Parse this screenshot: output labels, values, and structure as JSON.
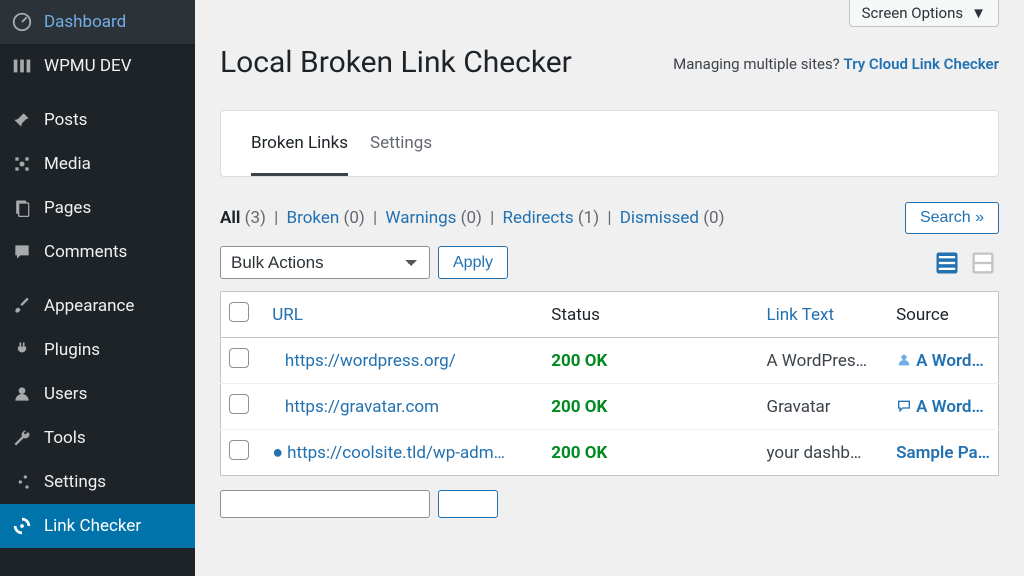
{
  "sidebar": {
    "items": [
      {
        "label": "Dashboard",
        "icon": "dashboard"
      },
      {
        "label": "WPMU DEV",
        "icon": "wpmudev"
      },
      {
        "label": "Posts",
        "icon": "pin"
      },
      {
        "label": "Media",
        "icon": "media"
      },
      {
        "label": "Pages",
        "icon": "pages"
      },
      {
        "label": "Comments",
        "icon": "comment"
      },
      {
        "label": "Appearance",
        "icon": "brush"
      },
      {
        "label": "Plugins",
        "icon": "plug"
      },
      {
        "label": "Users",
        "icon": "user"
      },
      {
        "label": "Tools",
        "icon": "wrench"
      },
      {
        "label": "Settings",
        "icon": "sliders"
      },
      {
        "label": "Link Checker",
        "icon": "linkchecker",
        "active": true
      }
    ]
  },
  "screen_options": "Screen Options",
  "page_title": "Local Broken Link Checker",
  "subtitle_text": "Managing multiple sites? ",
  "subtitle_link": "Try Cloud Link Checker",
  "tabs": [
    {
      "label": "Broken Links",
      "active": true
    },
    {
      "label": "Settings",
      "active": false
    }
  ],
  "filters": {
    "all_label": "All",
    "all_count": "(3)",
    "broken_label": "Broken",
    "broken_count": "(0)",
    "warnings_label": "Warnings",
    "warnings_count": "(0)",
    "redirects_label": "Redirects",
    "redirects_count": "(1)",
    "dismissed_label": "Dismissed",
    "dismissed_count": "(0)"
  },
  "search_button": "Search »",
  "bulk_select": "Bulk Actions",
  "apply_button": "Apply",
  "table": {
    "headers": {
      "url": "URL",
      "status": "Status",
      "linktext": "Link Text",
      "source": "Source"
    },
    "rows": [
      {
        "url": "https://wordpress.org/",
        "status": "200 OK",
        "linktext": "A WordPres…",
        "source": "A Word…",
        "source_icon": "user"
      },
      {
        "url": "https://gravatar.com",
        "status": "200 OK",
        "linktext": "Gravatar",
        "source": "A Word…",
        "source_icon": "comment"
      },
      {
        "url": "https://coolsite.tld/wp-adm…",
        "status": "200 OK",
        "linktext": "your dashb…",
        "source": "Sample Pa…",
        "dot": true
      }
    ]
  }
}
